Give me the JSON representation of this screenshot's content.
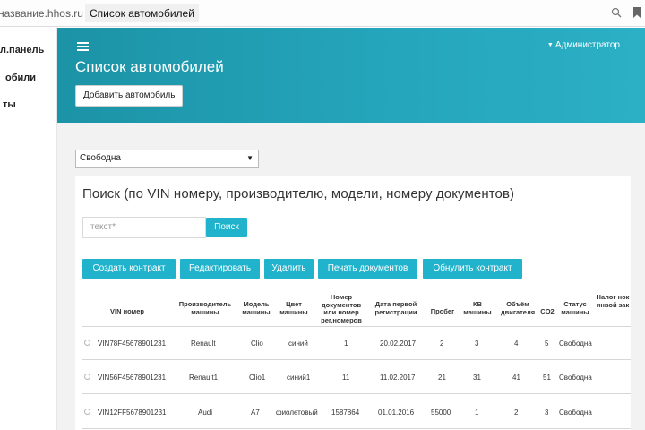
{
  "browser": {
    "url": "название.hhos.ru",
    "tab_title": "Список автомобилей"
  },
  "sidebar": {
    "items": [
      {
        "label": "л.панель"
      },
      {
        "label": "обили"
      },
      {
        "label": "ты"
      }
    ]
  },
  "header": {
    "title": "Список автомобилей",
    "user": "Администратор",
    "add_button": "Добавить автомобиль"
  },
  "filter": {
    "status_value": "Свободна"
  },
  "search": {
    "heading": "Поиск (по VIN номеру, производителю, модели, номеру документов)",
    "placeholder": "текст*",
    "button": "Поиск"
  },
  "actions": {
    "create": "Создать контракт",
    "edit": "Редактировать",
    "delete": "Удалить",
    "print": "Печать документов",
    "reset": "Обнулить контракт"
  },
  "table": {
    "headers": {
      "vin": "VIN номер",
      "maker": "Производитель машины",
      "model": "Модель машины",
      "color": "Цвет машины",
      "docs": "Номер документов или номер рег.номеров",
      "first_reg": "Дата первой регистрации",
      "mileage": "Пробег",
      "kw": "КВ машины",
      "volume": "Объём двигателя",
      "co2": "CO2",
      "status": "Статус машины",
      "tax": "Налог нок инвой зак"
    },
    "rows": [
      {
        "vin": "VIN78F45678901231",
        "maker": "Renault",
        "model": "Clio",
        "color": "синий",
        "docs": "1",
        "first_reg": "20.02.2017",
        "mileage": "2",
        "kw": "3",
        "volume": "4",
        "co2": "5",
        "status": "Свободна"
      },
      {
        "vin": "VIN56F45678901231",
        "maker": "Renault1",
        "model": "Clio1",
        "color": "синий1",
        "docs": "11",
        "first_reg": "11.02.2017",
        "mileage": "21",
        "kw": "31",
        "volume": "41",
        "co2": "51",
        "status": "Свободна"
      },
      {
        "vin": "VIN12FF5678901231",
        "maker": "Audi",
        "model": "A7",
        "color": "фиолетовый",
        "docs": "1587864",
        "first_reg": "01.01.2016",
        "mileage": "55000",
        "kw": "1",
        "volume": "2",
        "co2": "3",
        "status": "Свободна"
      }
    ]
  },
  "colors": {
    "accent": "#21b3cb",
    "banner": "#1c93a6"
  },
  "icons": {
    "search": "search-icon",
    "bookmark": "bookmark-icon",
    "menu": "hamburger-icon",
    "caret": "caret-down-icon"
  }
}
